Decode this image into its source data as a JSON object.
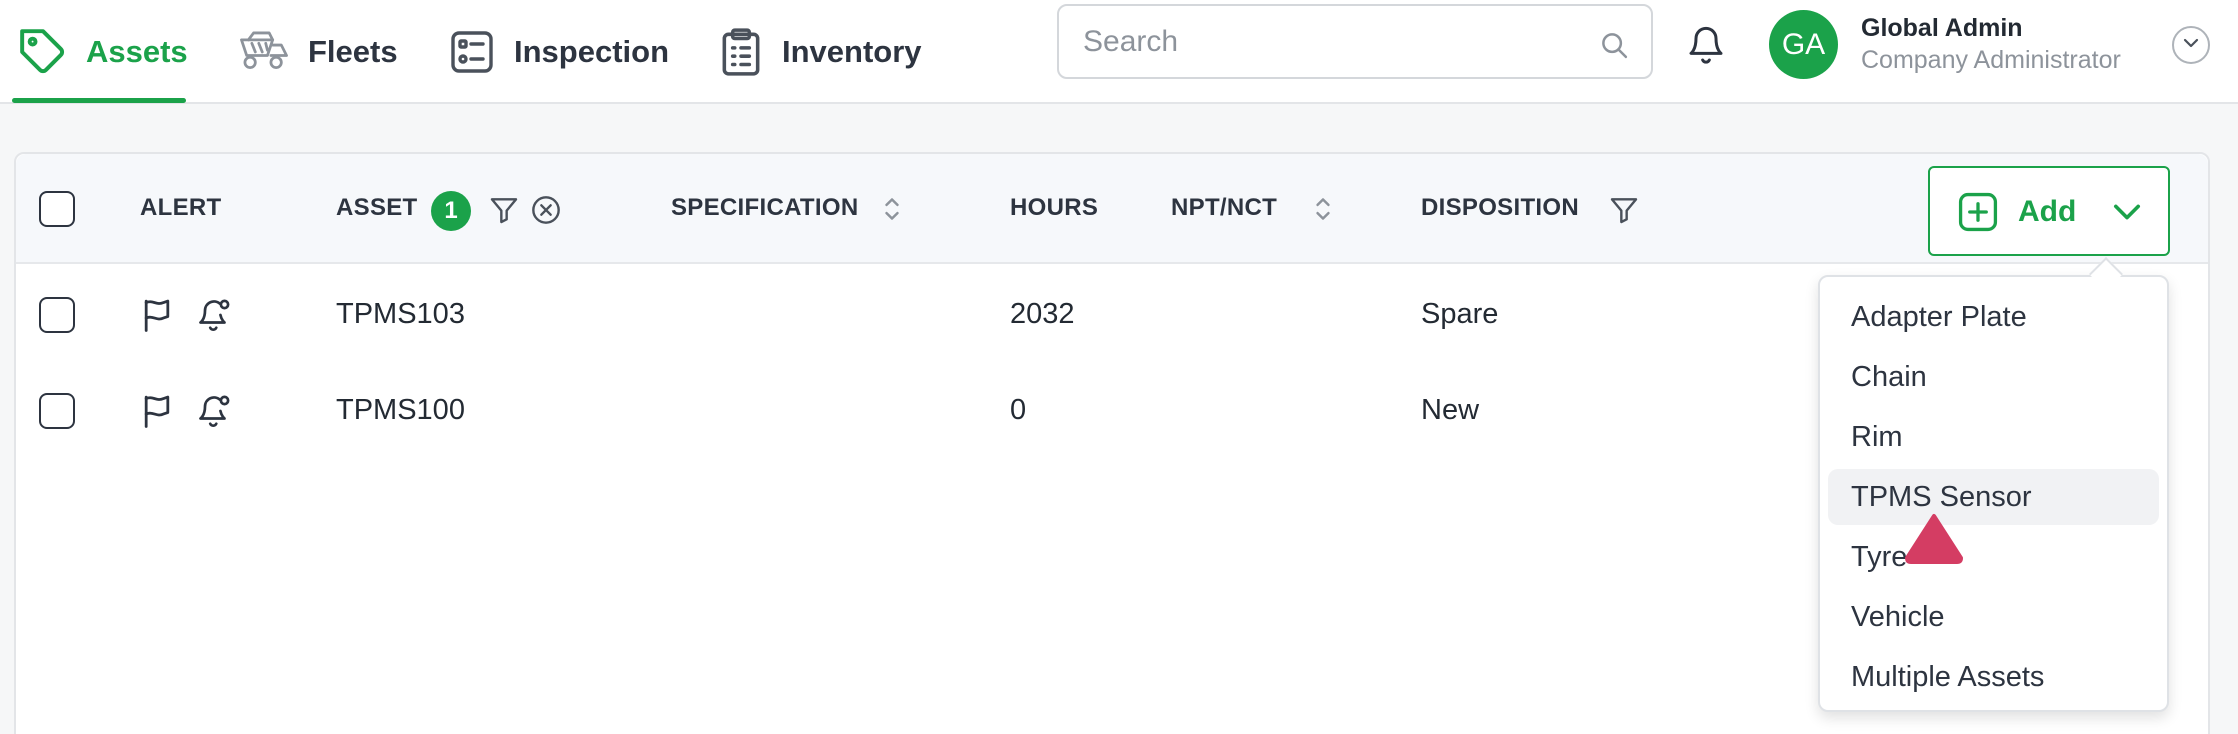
{
  "nav": {
    "tabs": [
      {
        "label": "Assets",
        "icon": "tag-icon",
        "active": true
      },
      {
        "label": "Fleets",
        "icon": "truck-icon",
        "active": false
      },
      {
        "label": "Inspection",
        "icon": "checklist-icon",
        "active": false
      },
      {
        "label": "Inventory",
        "icon": "clipboard-icon",
        "active": false
      }
    ]
  },
  "search": {
    "placeholder": "Search",
    "value": ""
  },
  "user": {
    "initials": "GA",
    "name": "Global Admin",
    "role": "Company Administrator"
  },
  "table": {
    "headers": {
      "alert": "ALERT",
      "asset": "ASSET",
      "asset_filter_count": "1",
      "specification": "SPECIFICATION",
      "hours": "HOURS",
      "npt_nct": "NPT/NCT",
      "disposition": "DISPOSITION"
    },
    "rows": [
      {
        "asset": "TPMS103",
        "specification": "",
        "hours": "2032",
        "npt_nct": "",
        "disposition": "Spare"
      },
      {
        "asset": "TPMS100",
        "specification": "",
        "hours": "0",
        "npt_nct": "",
        "disposition": "New"
      }
    ]
  },
  "add_button": {
    "label": "Add"
  },
  "add_menu": {
    "items": [
      {
        "label": "Adapter Plate",
        "hovered": false
      },
      {
        "label": "Chain",
        "hovered": false
      },
      {
        "label": "Rim",
        "hovered": false
      },
      {
        "label": "TPMS Sensor",
        "hovered": true
      },
      {
        "label": "Tyre",
        "hovered": false
      },
      {
        "label": "Vehicle",
        "hovered": false
      },
      {
        "label": "Multiple Assets",
        "hovered": false
      }
    ]
  },
  "colors": {
    "accent": "#1ba24a",
    "text": "#232a33",
    "muted": "#8d939b",
    "cursor": "#d43d63"
  }
}
